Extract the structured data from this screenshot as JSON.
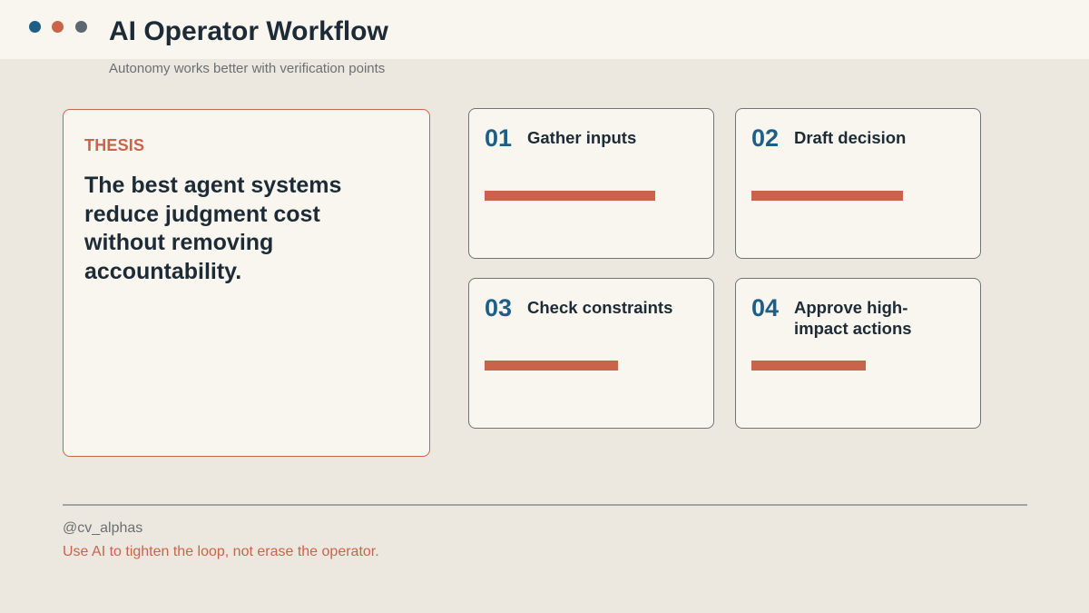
{
  "header": {
    "title": "AI Operator Workflow",
    "subtitle": "Autonomy works better with verification points",
    "dots": [
      {
        "name": "blue-dot",
        "color": "#1f5f86"
      },
      {
        "name": "orange-dot",
        "color": "#c9644a"
      },
      {
        "name": "gray-dot",
        "color": "#5d6770"
      }
    ]
  },
  "thesis": {
    "kicker": "THESIS",
    "text": "The best agent systems reduce judgment cost without removing accountability."
  },
  "steps": [
    {
      "number": "01",
      "title": "Gather inputs",
      "progress": 0.82
    },
    {
      "number": "02",
      "title": "Draft decision",
      "progress": 0.73
    },
    {
      "number": "03",
      "title": "Check constraints",
      "progress": 0.64
    },
    {
      "number": "04",
      "title": "Approve high-impact actions",
      "progress": 0.55
    }
  ],
  "footer": {
    "handle": "@cv_alphas",
    "tagline": "Use AI to tighten the loop, not erase the operator."
  },
  "colors": {
    "accent": "#c9644a",
    "number": "#1f5f86",
    "background": "#ece8df",
    "card": "#f9f6ef"
  }
}
